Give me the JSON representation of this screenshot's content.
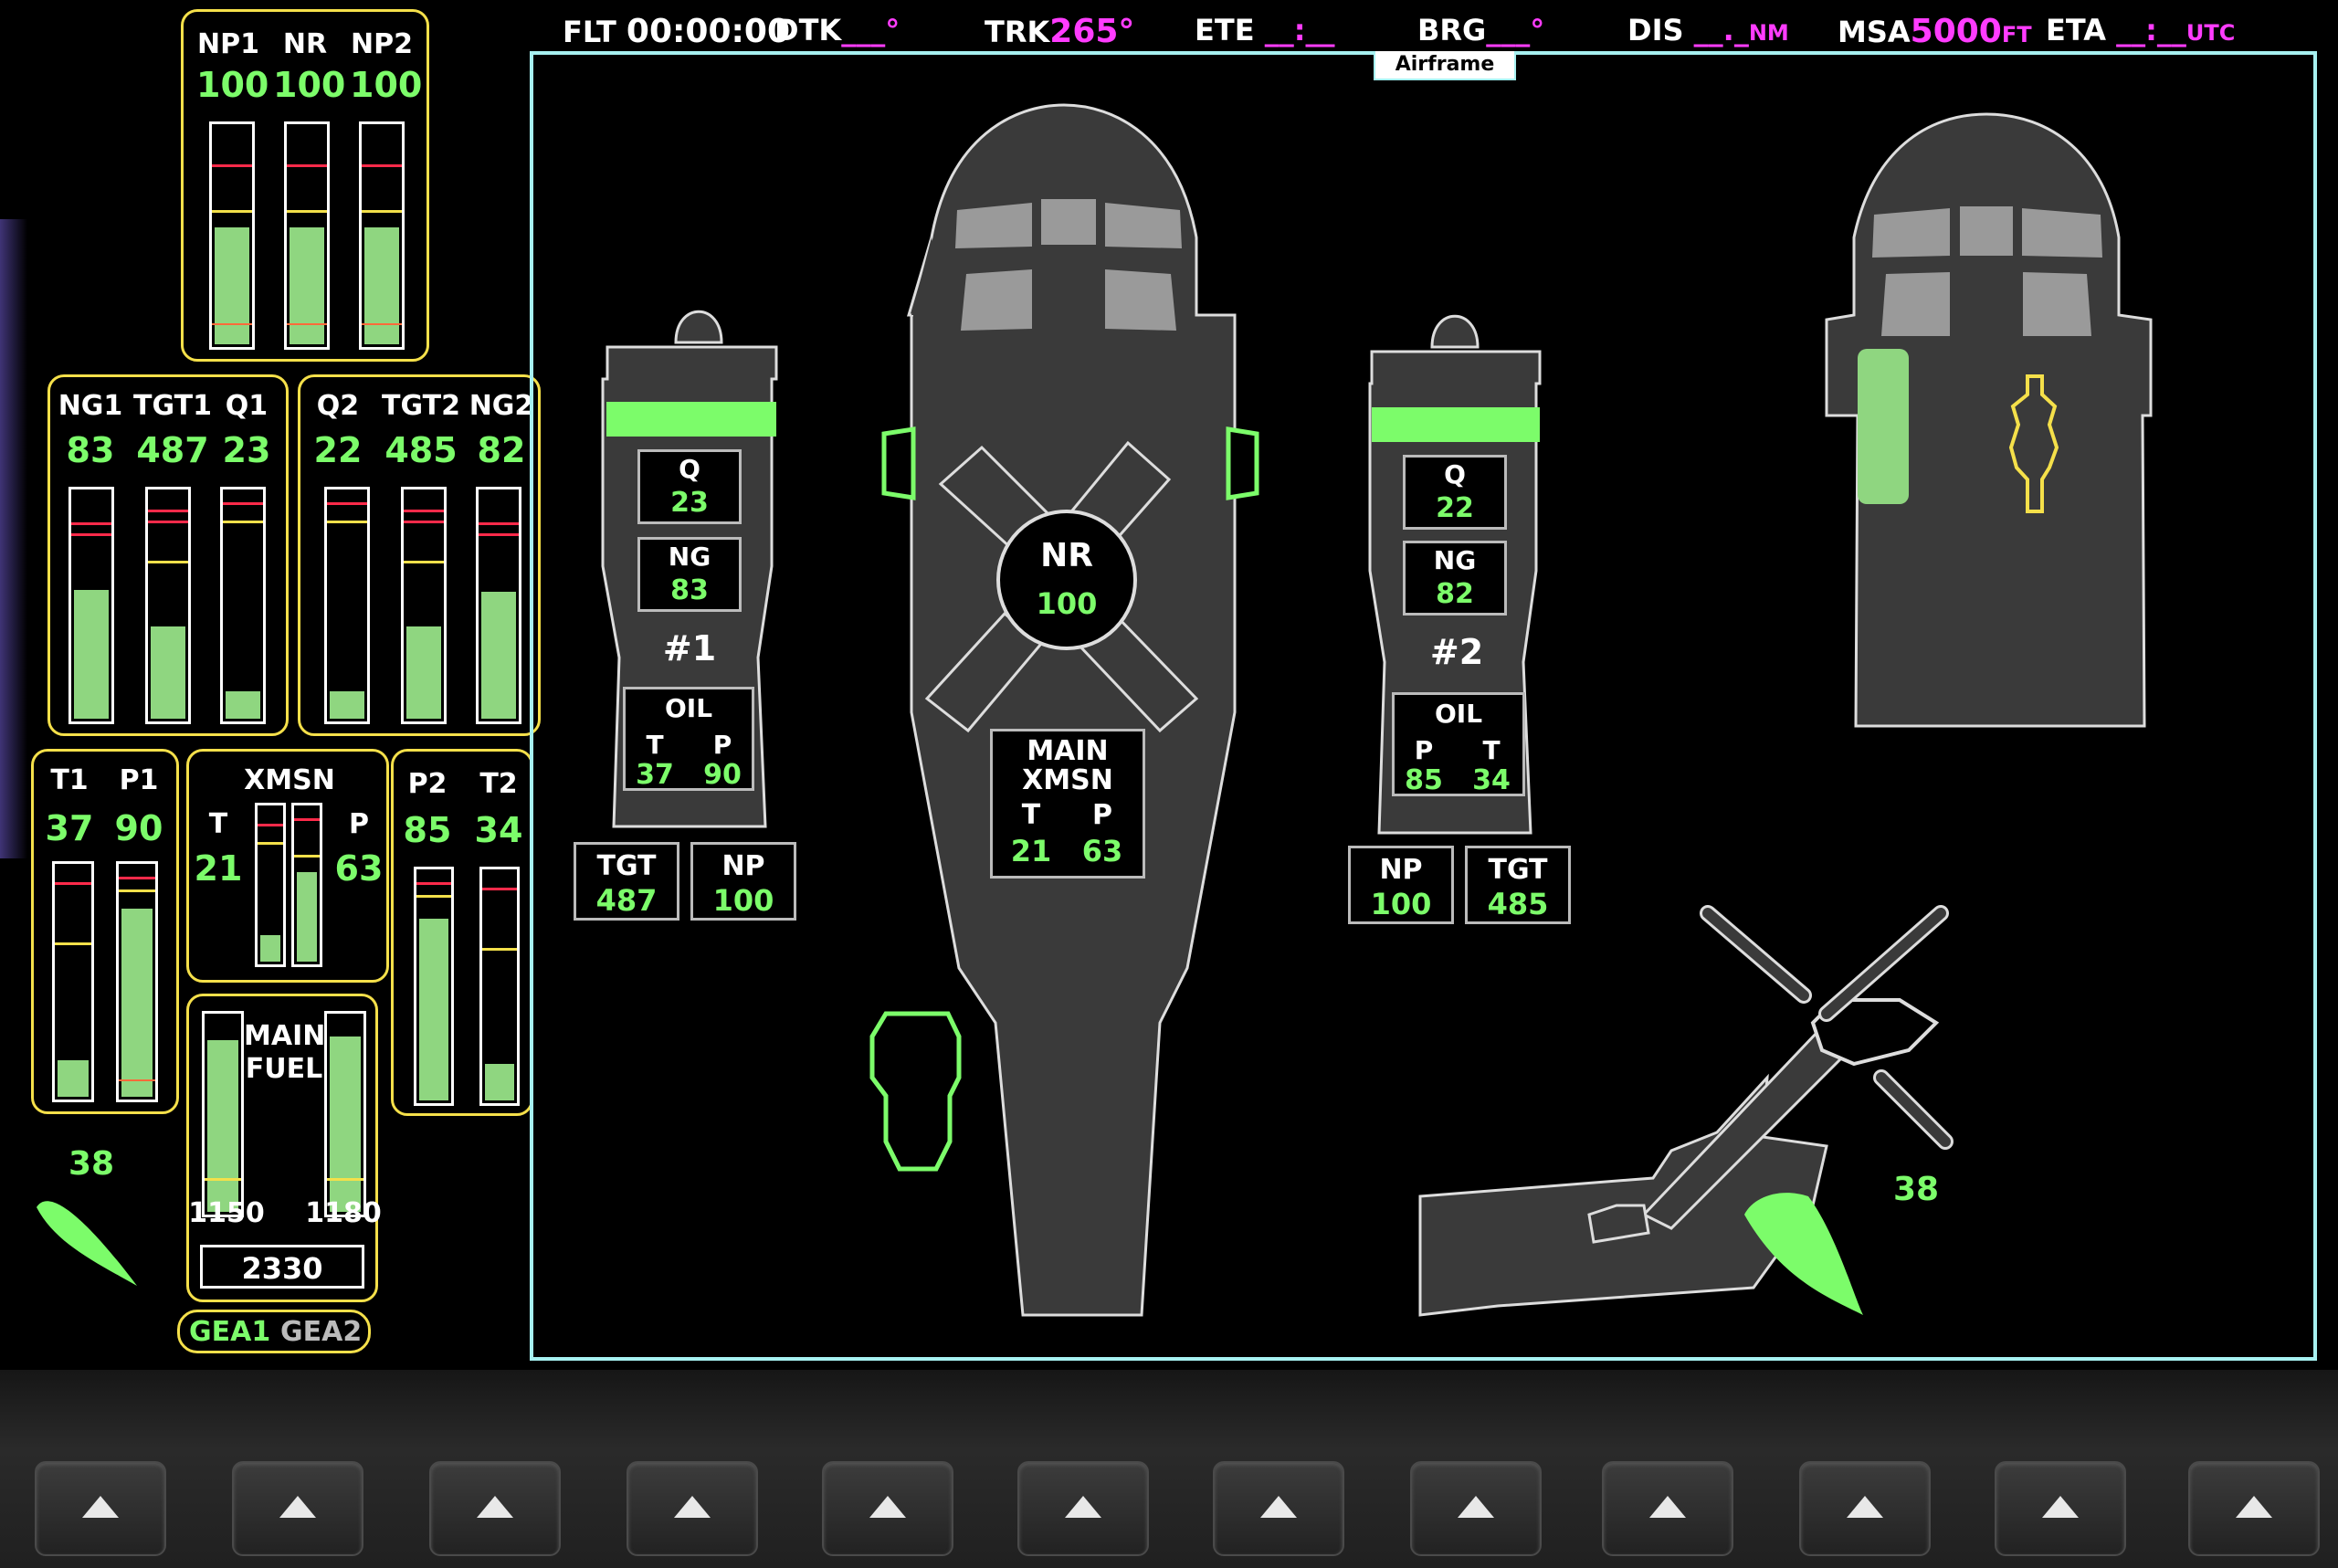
{
  "topbar": {
    "flt_label": "FLT",
    "flt_value": "00:00:00",
    "dtk_label": "DTK",
    "dtk_value": "___°",
    "trk_label": "TRK",
    "trk_value": "265°",
    "ete_label": "ETE",
    "ete_value": "__:__",
    "brg_label": "BRG",
    "brg_value": "___°",
    "dis_label": "DIS",
    "dis_value": "__._",
    "dis_unit": "NM",
    "msa_label": "MSA",
    "msa_value": "5000",
    "msa_unit": "FT",
    "eta_label": "ETA",
    "eta_value": "__:__",
    "eta_unit": "UTC"
  },
  "window": {
    "title": "Airframe"
  },
  "rotor_group": {
    "labels": [
      "NP1",
      "NR",
      "NP2"
    ],
    "values": [
      "100",
      "100",
      "100"
    ],
    "levels": [
      0.55,
      0.55,
      0.55
    ]
  },
  "engine1_group": {
    "labels": [
      "NG1",
      "TGT1",
      "Q1"
    ],
    "values": [
      "83",
      "487",
      "23"
    ],
    "levels": [
      0.58,
      0.42,
      0.14
    ]
  },
  "engine2_group": {
    "labels": [
      "Q2",
      "TGT2",
      "NG2"
    ],
    "values": [
      "22",
      "485",
      "82"
    ],
    "levels": [
      0.14,
      0.42,
      0.57
    ]
  },
  "oil1_group": {
    "labels": [
      "T1",
      "P1"
    ],
    "values": [
      "37",
      "90"
    ],
    "levels": [
      0.18,
      0.82
    ]
  },
  "xmsn_group": {
    "title": "XMSN",
    "t_label": "T",
    "t_value": "21",
    "p_label": "P",
    "p_value": "63",
    "levels": [
      0.2,
      0.6
    ]
  },
  "oil2_group": {
    "labels": [
      "P2",
      "T2"
    ],
    "values": [
      "85",
      "34"
    ],
    "levels": [
      0.8,
      0.18
    ]
  },
  "fuel_group": {
    "title_line1": "MAIN",
    "title_line2": "FUEL",
    "left_value": "1150",
    "right_value": "1180",
    "total": "2330",
    "levels": [
      0.88,
      0.9
    ]
  },
  "gea_tabs": {
    "gea1": "GEA1",
    "gea2": "GEA2"
  },
  "attitude_left": {
    "value": "38"
  },
  "engine1": {
    "q_label": "Q",
    "q_value": "23",
    "ng_label": "NG",
    "ng_value": "83",
    "name": "#1",
    "oil_label": "OIL",
    "t_label": "T",
    "t_value": "37",
    "p_label": "P",
    "p_value": "90",
    "tgt_label": "TGT",
    "tgt_value": "487",
    "np_label": "NP",
    "np_value": "100"
  },
  "engine2": {
    "q_label": "Q",
    "q_value": "22",
    "ng_label": "NG",
    "ng_value": "82",
    "name": "#2",
    "oil_label": "OIL",
    "p_label": "P",
    "p_value": "85",
    "t_label": "T",
    "t_value": "34",
    "np_label": "NP",
    "np_value": "100",
    "tgt_label": "TGT",
    "tgt_value": "485"
  },
  "rotor_hub": {
    "label": "NR",
    "value": "100"
  },
  "main_xmsn": {
    "line1": "MAIN",
    "line2": "XMSN",
    "t_label": "T",
    "t_value": "21",
    "p_label": "P",
    "p_value": "63"
  },
  "attitude_right": {
    "value": "38"
  },
  "colors": {
    "green": "#7cfc6a",
    "yellow": "#f5e04a",
    "magenta": "#ff3cff",
    "cyan": "#a6f0f0",
    "airframe": "#3a3a3a"
  }
}
